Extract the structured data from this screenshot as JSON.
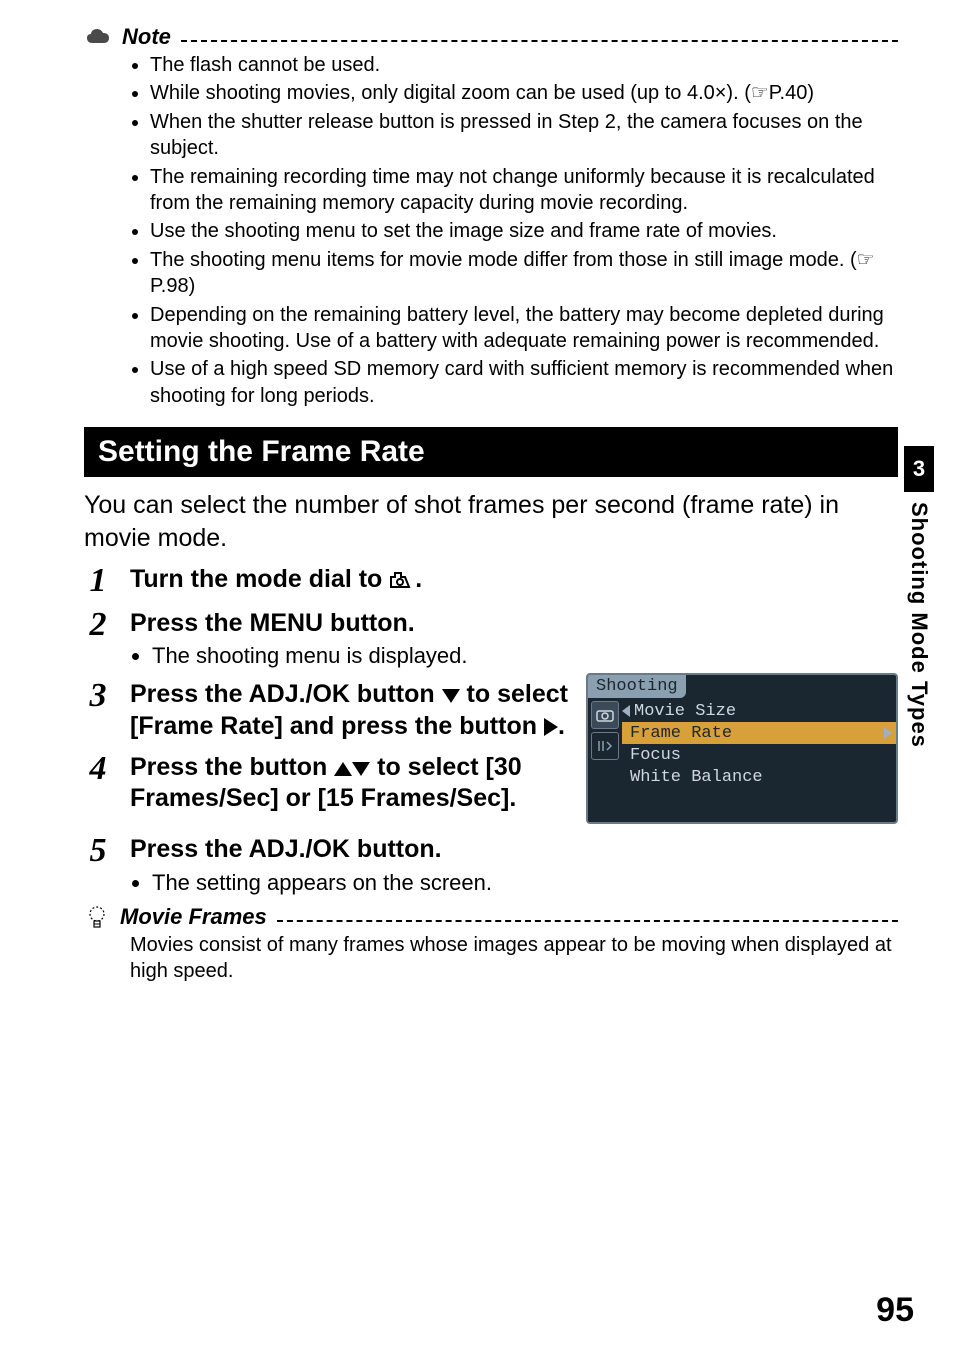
{
  "note": {
    "label": "Note",
    "items": [
      "The flash cannot be used.",
      "While shooting movies, only digital zoom can be used (up to 4.0×). (☞P.40)",
      "When the shutter release button is pressed in Step 2, the camera focuses on the subject.",
      "The remaining recording time may not change uniformly because it is recalculated from the remaining memory capacity during movie recording.",
      "Use the shooting menu to set the image size and frame rate of movies.",
      "The shooting menu items for movie mode differ from those in still image mode. (☞P.98)",
      "Depending on the remaining battery level, the battery may become depleted during movie shooting. Use of a battery with adequate remaining power is recommended.",
      "Use of a high speed SD memory card with sufficient memory is recommended when shooting for long periods."
    ]
  },
  "section_title": "Setting the Frame Rate",
  "intro": "You can select the number of shot frames per second (frame rate) in movie mode.",
  "steps": {
    "s1_a": "Turn the mode dial to ",
    "s1_b": ".",
    "s2": "Press the MENU button.",
    "s2_sub": "The shooting menu is displayed.",
    "s3_a": "Press the ADJ./OK button ",
    "s3_b": " to select [Frame Rate] and press the button ",
    "s3_c": ".",
    "s4_a": "Press the button ",
    "s4_b": " to select [30 Frames/Sec] or [15 Frames/Sec].",
    "s5": "Press the ADJ./OK button.",
    "s5_sub": "The setting appears on the screen."
  },
  "screenshot": {
    "header": "Shooting",
    "rows": [
      "Movie Size",
      "Frame Rate",
      "Focus",
      "White Balance"
    ]
  },
  "tip": {
    "label": "Movie Frames",
    "text": "Movies consist of many frames whose images appear to be moving when displayed at high speed."
  },
  "side": {
    "num": "3",
    "text": "Shooting Mode Types"
  },
  "page_number": "95"
}
